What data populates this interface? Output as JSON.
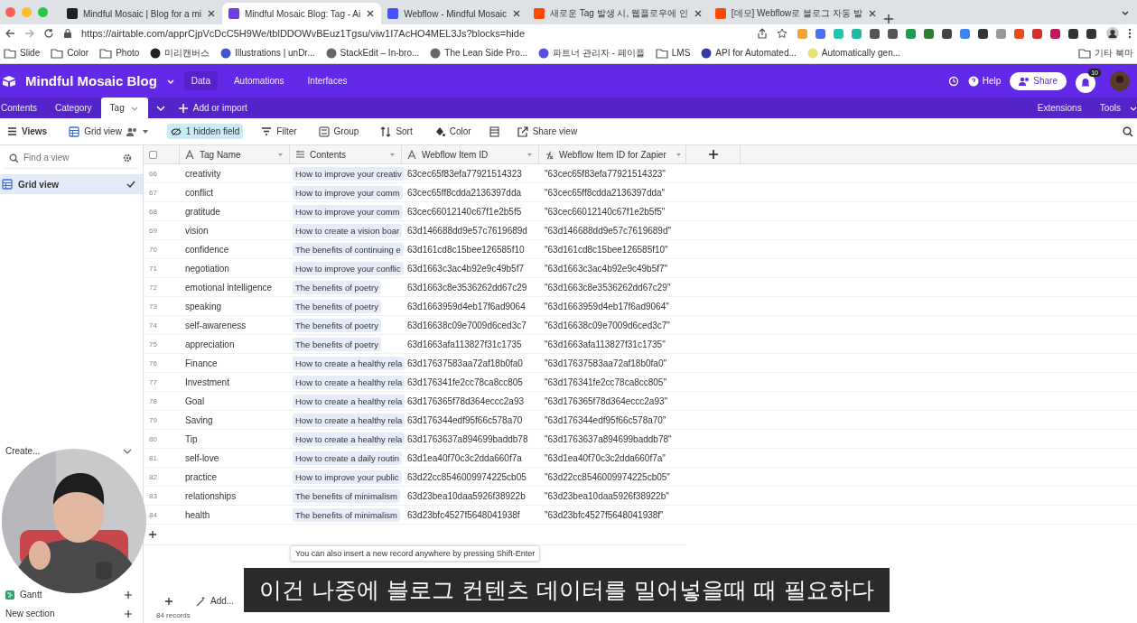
{
  "browser": {
    "tabs": [
      {
        "title": "Mindful Mosaic | Blog for a mi",
        "selected": false
      },
      {
        "title": "Mindful Mosaic Blog: Tag - Ai",
        "selected": true
      },
      {
        "title": "Webflow - Mindful Mosaic",
        "selected": false
      },
      {
        "title": "새로운 Tag 발생 시, 웹플로우에 인",
        "selected": false
      },
      {
        "title": "[데모] Webflow로 블로그 자동 발",
        "selected": false
      }
    ],
    "address": "https://airtable.com/apprCjpVcDcC5H9We/tblDDOWvBEuz1Tgsu/viw1I7AcHO4MEL3Js?blocks=hide",
    "bookmarks": [
      {
        "label": "Slide",
        "kind": "folder"
      },
      {
        "label": "Color",
        "kind": "folder"
      },
      {
        "label": "Photo",
        "kind": "folder"
      },
      {
        "label": "미리캔버스",
        "kind": "site"
      },
      {
        "label": "Illustrations | unDr...",
        "kind": "site"
      },
      {
        "label": "StackEdit – In-bro...",
        "kind": "site"
      },
      {
        "label": "The Lean Side Pro...",
        "kind": "site"
      },
      {
        "label": "파트너 관리자 - 페이플",
        "kind": "site"
      },
      {
        "label": "LMS",
        "kind": "folder"
      },
      {
        "label": "API for Automated...",
        "kind": "site"
      },
      {
        "label": "Automatically gen...",
        "kind": "site"
      }
    ],
    "other_bookmarks": "기타 북마"
  },
  "app": {
    "title": "Mindful Mosaic Blog",
    "nav": [
      {
        "label": "Data",
        "selected": true
      },
      {
        "label": "Automations",
        "selected": false
      },
      {
        "label": "Interfaces",
        "selected": false
      }
    ],
    "help": "Help",
    "share": "Share",
    "notification_count": "10",
    "tables": [
      {
        "label": "Contents",
        "selected": false
      },
      {
        "label": "Category",
        "selected": false
      },
      {
        "label": "Tag",
        "selected": true
      }
    ],
    "add_table": "Add or import",
    "extensions": "Extensions",
    "tools": "Tools"
  },
  "toolbar": {
    "views": "Views",
    "view_name": "Grid view",
    "hidden_fields": "1 hidden field",
    "buttons": [
      "Filter",
      "Group",
      "Sort",
      "Color"
    ],
    "share_view": "Share view"
  },
  "sidebar": {
    "search_placeholder": "Find a view",
    "views": [
      {
        "label": "Grid view",
        "selected": true
      }
    ],
    "create": "Create...",
    "create_items": [
      "Gantt"
    ],
    "new_section": "New section"
  },
  "table": {
    "select_all_checked": false,
    "columns": [
      "Tag Name",
      "Contents",
      "Webflow Item ID",
      "Webflow Item ID for Zapier"
    ],
    "rows": [
      {
        "number": "66",
        "tag": "creativity",
        "contents": "How to improve your creativ",
        "webflow_id": "63cec65f83efa77921514323",
        "zapier_id": "\"63cec65f83efa77921514323\""
      },
      {
        "number": "67",
        "tag": "conflict",
        "contents": "How to improve your comm",
        "webflow_id": "63cec65ff8cdda2136397dda",
        "zapier_id": "\"63cec65ff8cdda2136397dda\""
      },
      {
        "number": "68",
        "tag": "gratitude",
        "contents": "How to improve your comm",
        "webflow_id": "63cec66012140c67f1e2b5f5",
        "zapier_id": "\"63cec66012140c67f1e2b5f5\""
      },
      {
        "number": "69",
        "tag": "vision",
        "contents": "How to create a vision boar",
        "webflow_id": "63d146688dd9e57c7619689d",
        "zapier_id": "\"63d146688dd9e57c7619689d\""
      },
      {
        "number": "70",
        "tag": "confidence",
        "contents": "The benefits of continuing e",
        "webflow_id": "63d161cd8c15bee126585f10",
        "zapier_id": "\"63d161cd8c15bee126585f10\""
      },
      {
        "number": "71",
        "tag": "negotiation",
        "contents": "How to improve your conflic",
        "webflow_id": "63d1663c3ac4b92e9c49b5f7",
        "zapier_id": "\"63d1663c3ac4b92e9c49b5f7\""
      },
      {
        "number": "72",
        "tag": "emotional intelligence",
        "contents": "The benefits of poetry",
        "webflow_id": "63d1663c8e3536262dd67c29",
        "zapier_id": "\"63d1663c8e3536262dd67c29\""
      },
      {
        "number": "73",
        "tag": "speaking",
        "contents": "The benefits of poetry",
        "webflow_id": "63d1663959d4eb17f6ad9064",
        "zapier_id": "\"63d1663959d4eb17f6ad9064\""
      },
      {
        "number": "74",
        "tag": "self-awareness",
        "contents": "The benefits of poetry",
        "webflow_id": "63d16638c09e7009d6ced3c7",
        "zapier_id": "\"63d16638c09e7009d6ced3c7\""
      },
      {
        "number": "75",
        "tag": "appreciation",
        "contents": "The benefits of poetry",
        "webflow_id": "63d1663afa113827f31c1735",
        "zapier_id": "\"63d1663afa113827f31c1735\""
      },
      {
        "number": "76",
        "tag": "Finance",
        "contents": "How to create a healthy rela",
        "webflow_id": "63d17637583aa72af18b0fa0",
        "zapier_id": "\"63d17637583aa72af18b0fa0\""
      },
      {
        "number": "77",
        "tag": "Investment",
        "contents": "How to create a healthy rela",
        "webflow_id": "63d176341fe2cc78ca8cc805",
        "zapier_id": "\"63d176341fe2cc78ca8cc805\""
      },
      {
        "number": "78",
        "tag": "Goal",
        "contents": "How to create a healthy rela",
        "webflow_id": "63d176365f78d364eccc2a93",
        "zapier_id": "\"63d176365f78d364eccc2a93\""
      },
      {
        "number": "79",
        "tag": "Saving",
        "contents": "How to create a healthy rela",
        "webflow_id": "63d176344edf95f66c578a70",
        "zapier_id": "\"63d176344edf95f66c578a70\""
      },
      {
        "number": "80",
        "tag": "Tip",
        "contents": "How to create a healthy rela",
        "webflow_id": "63d1763637a894699baddb78",
        "zapier_id": "\"63d1763637a894699baddb78\""
      },
      {
        "number": "81",
        "tag": "self-love",
        "contents": "How to create a daily routin",
        "webflow_id": "63d1ea40f70c3c2dda660f7a",
        "zapier_id": "\"63d1ea40f70c3c2dda660f7a\""
      },
      {
        "number": "82",
        "tag": "practice",
        "contents": "How to improve your public",
        "webflow_id": "63d22cc8546009974225cb05",
        "zapier_id": "\"63d22cc8546009974225cb05\""
      },
      {
        "number": "83",
        "tag": "relationships",
        "contents": "The benefits of minimalism",
        "webflow_id": "63d23bea10daa5926f38922b",
        "zapier_id": "\"63d23bea10daa5926f38922b\""
      },
      {
        "number": "84",
        "tag": "health",
        "contents": "The benefits of minimalism",
        "webflow_id": "63d23bfc4527f5648041938f",
        "zapier_id": "\"63d23bfc4527f5648041938f\""
      }
    ],
    "tooltip": "You can also insert a new record anywhere by pressing Shift-Enter",
    "add_label": "Add...",
    "record_count": "84 records"
  },
  "subtitle": "이건 나중에 블로그 컨텐츠 데이터를 밀어넣을때 때 필요하다"
}
